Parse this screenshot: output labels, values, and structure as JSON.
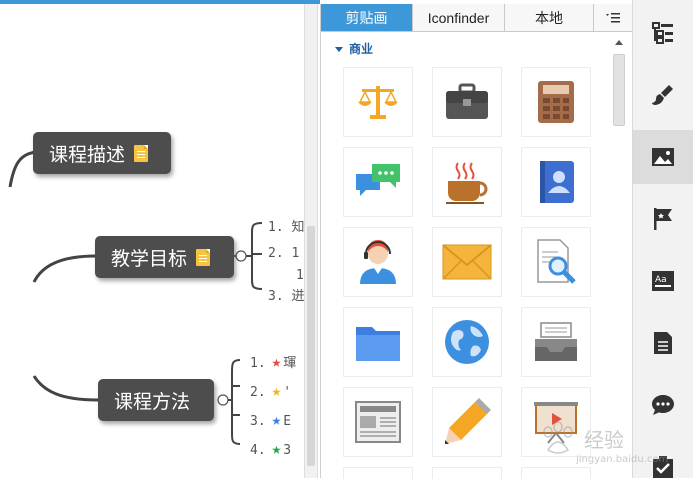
{
  "mindmap": {
    "nodes": [
      {
        "label": "课程描述"
      },
      {
        "label": "教学目标"
      },
      {
        "label": "课程方法"
      }
    ],
    "goal_items": [
      "1. 知",
      "2. 1",
      "3. 迸"
    ],
    "goal_third_prefix": "1",
    "method_items": [
      "1.",
      "2.",
      "3.",
      "4."
    ],
    "method_item_chars": [
      "琿",
      "'",
      "E",
      "3"
    ]
  },
  "clipart_panel": {
    "tabs": [
      "剪贴画",
      "Iconfinder",
      "本地"
    ],
    "menu_icon": "list-menu-icon",
    "category": "商业",
    "icons": [
      "scales-icon",
      "briefcase-icon",
      "calculator-icon",
      "chat-bubbles-icon",
      "coffee-cup-icon",
      "contact-book-icon",
      "customer-service-icon",
      "envelope-icon",
      "document-search-icon",
      "folder-icon",
      "globe-icon",
      "inbox-tray-icon",
      "newspaper-icon",
      "pencil-icon",
      "presentation-board-icon"
    ]
  },
  "sidebar": {
    "buttons": [
      "outline-icon",
      "format-brush-icon",
      "image-icon",
      "flag-icon",
      "text-style-icon",
      "notes-icon",
      "comment-icon",
      "task-icon"
    ]
  },
  "watermark": {
    "text": "经验",
    "sub": "jingyan.baidu.com"
  },
  "colors": {
    "accent": "#3c98d8",
    "node": "#4d4d4d",
    "folder": "#f6c343"
  }
}
